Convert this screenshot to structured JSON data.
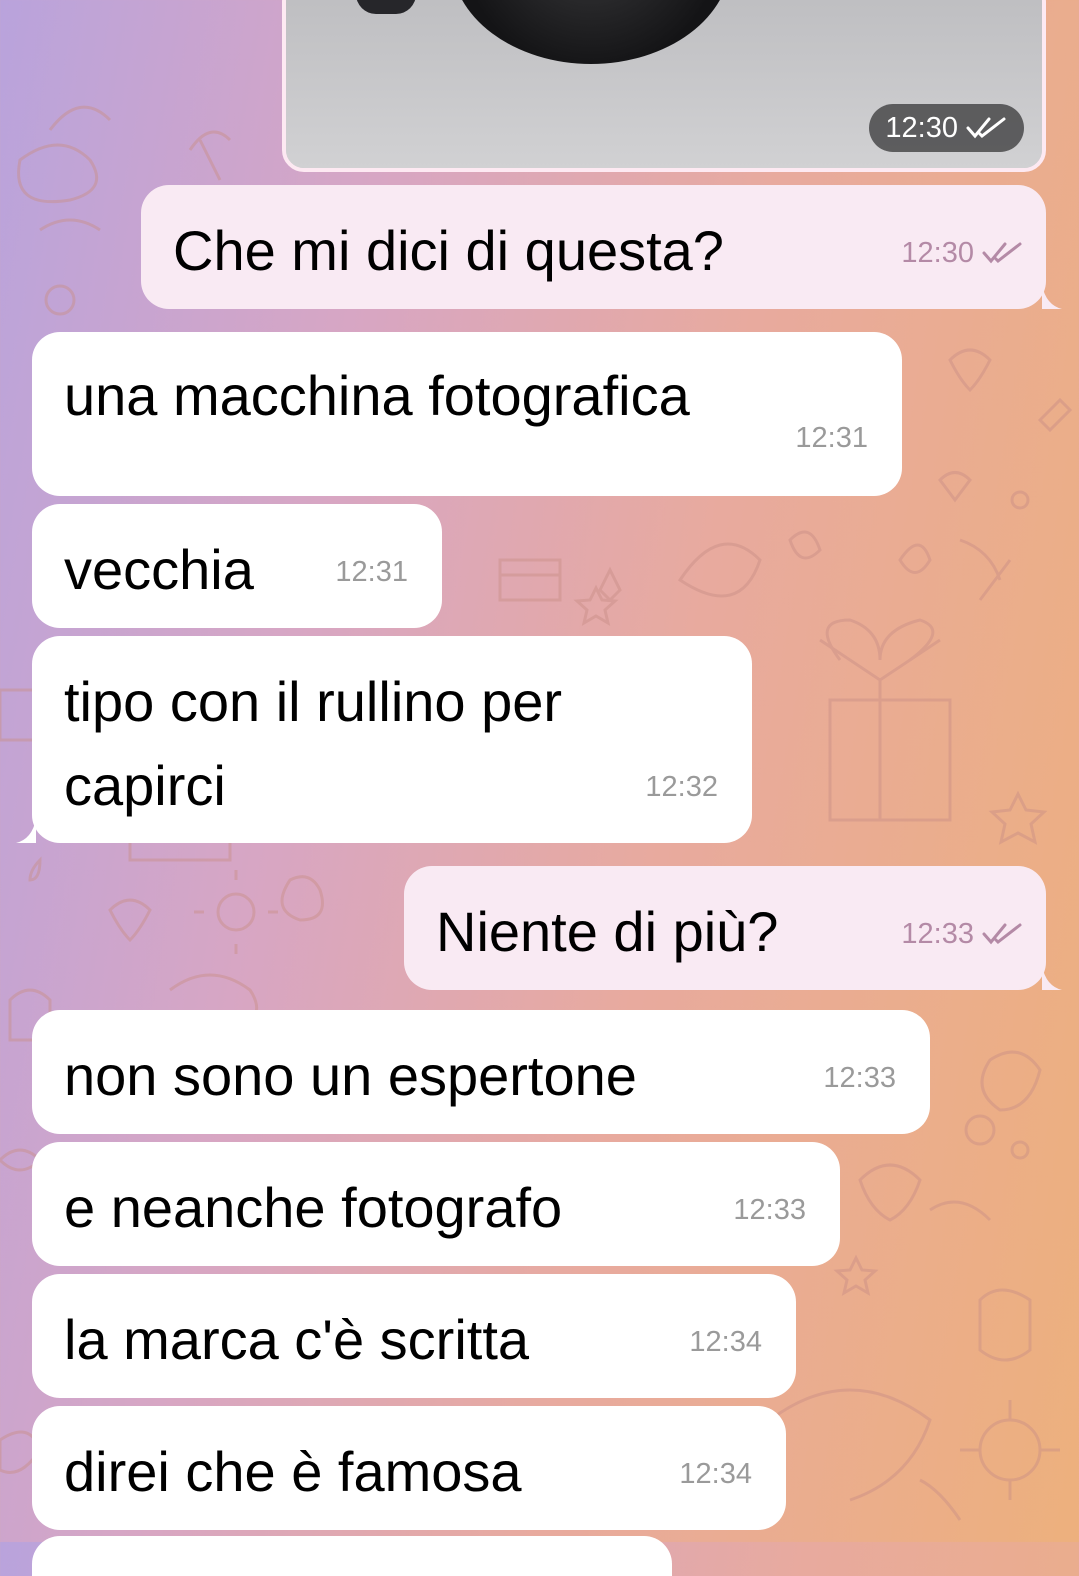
{
  "chat": {
    "photo_message": {
      "time": "12:30",
      "status": "read"
    },
    "messages": [
      {
        "direction": "out",
        "text": "Che mi dici di questa?",
        "time": "12:30",
        "status": "read"
      },
      {
        "direction": "in",
        "text": "una macchina fotografica",
        "time": "12:31"
      },
      {
        "direction": "in",
        "text": "vecchia",
        "time": "12:31"
      },
      {
        "direction": "in",
        "text": "tipo con il rullino per\ncapirci",
        "time": "12:32"
      },
      {
        "direction": "out",
        "text": "Niente di più?",
        "time": "12:33",
        "status": "read"
      },
      {
        "direction": "in",
        "text": "non sono un espertone",
        "time": "12:33"
      },
      {
        "direction": "in",
        "text": "e neanche fotografo",
        "time": "12:33"
      },
      {
        "direction": "in",
        "text": "la marca c'è scritta",
        "time": "12:34"
      },
      {
        "direction": "in",
        "text": "direi che è famosa",
        "time": "12:34"
      }
    ]
  },
  "colors": {
    "incoming_bubble": "#ffffff",
    "outgoing_bubble": "#f9eaf3",
    "read_ticks": "#b48aa6",
    "time_badge": "#3c3c3e"
  },
  "icons": {
    "read_status": "double-check-icon"
  }
}
